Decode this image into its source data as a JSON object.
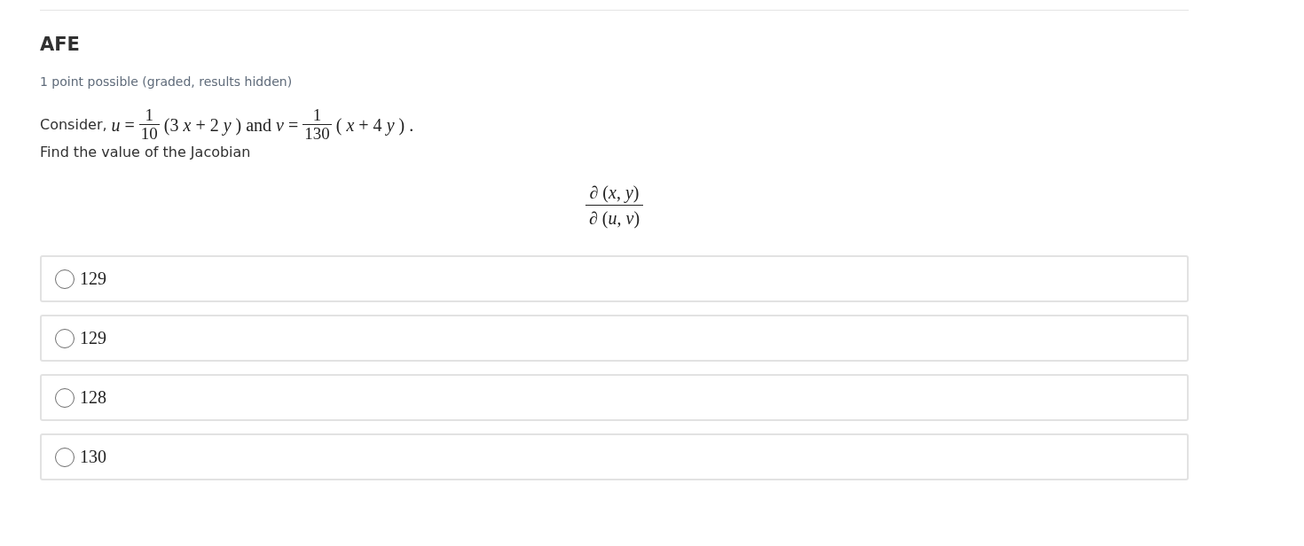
{
  "problem": {
    "title": "AFE",
    "meta": "1 point possible (graded, results hidden)",
    "statement": [
      [
        {
          "kind": "text",
          "text": "Consider,"
        },
        {
          "kind": "var",
          "text": "u"
        },
        {
          "kind": "math",
          "text": "="
        },
        {
          "kind": "fraction",
          "numerator": "1",
          "denominator": "10"
        },
        {
          "kind": "math",
          "text": "(3"
        },
        {
          "kind": "var",
          "text": "x"
        },
        {
          "kind": "math",
          "text": "+ 2"
        },
        {
          "kind": "var",
          "text": "y"
        },
        {
          "kind": "math",
          "text": ") and"
        },
        {
          "kind": "var",
          "text": "v"
        },
        {
          "kind": "math",
          "text": "="
        },
        {
          "kind": "fraction",
          "numerator": "1",
          "denominator": "130"
        },
        {
          "kind": "math",
          "text": "("
        },
        {
          "kind": "var",
          "text": "x"
        },
        {
          "kind": "math",
          "text": "+ 4"
        },
        {
          "kind": "var",
          "text": "y"
        },
        {
          "kind": "math",
          "text": ") ."
        }
      ],
      [
        {
          "kind": "text",
          "text": "Find the value of the Jacobian"
        }
      ]
    ],
    "display": {
      "kind": "fraction",
      "numerator": "∂ (*x*, *y*)",
      "denominator": "∂ (*u*, *v*)"
    },
    "choices": [
      {
        "label": "129",
        "selected": false
      },
      {
        "label": "129",
        "selected": false
      },
      {
        "label": "128",
        "selected": false
      },
      {
        "label": "130",
        "selected": false
      }
    ]
  }
}
